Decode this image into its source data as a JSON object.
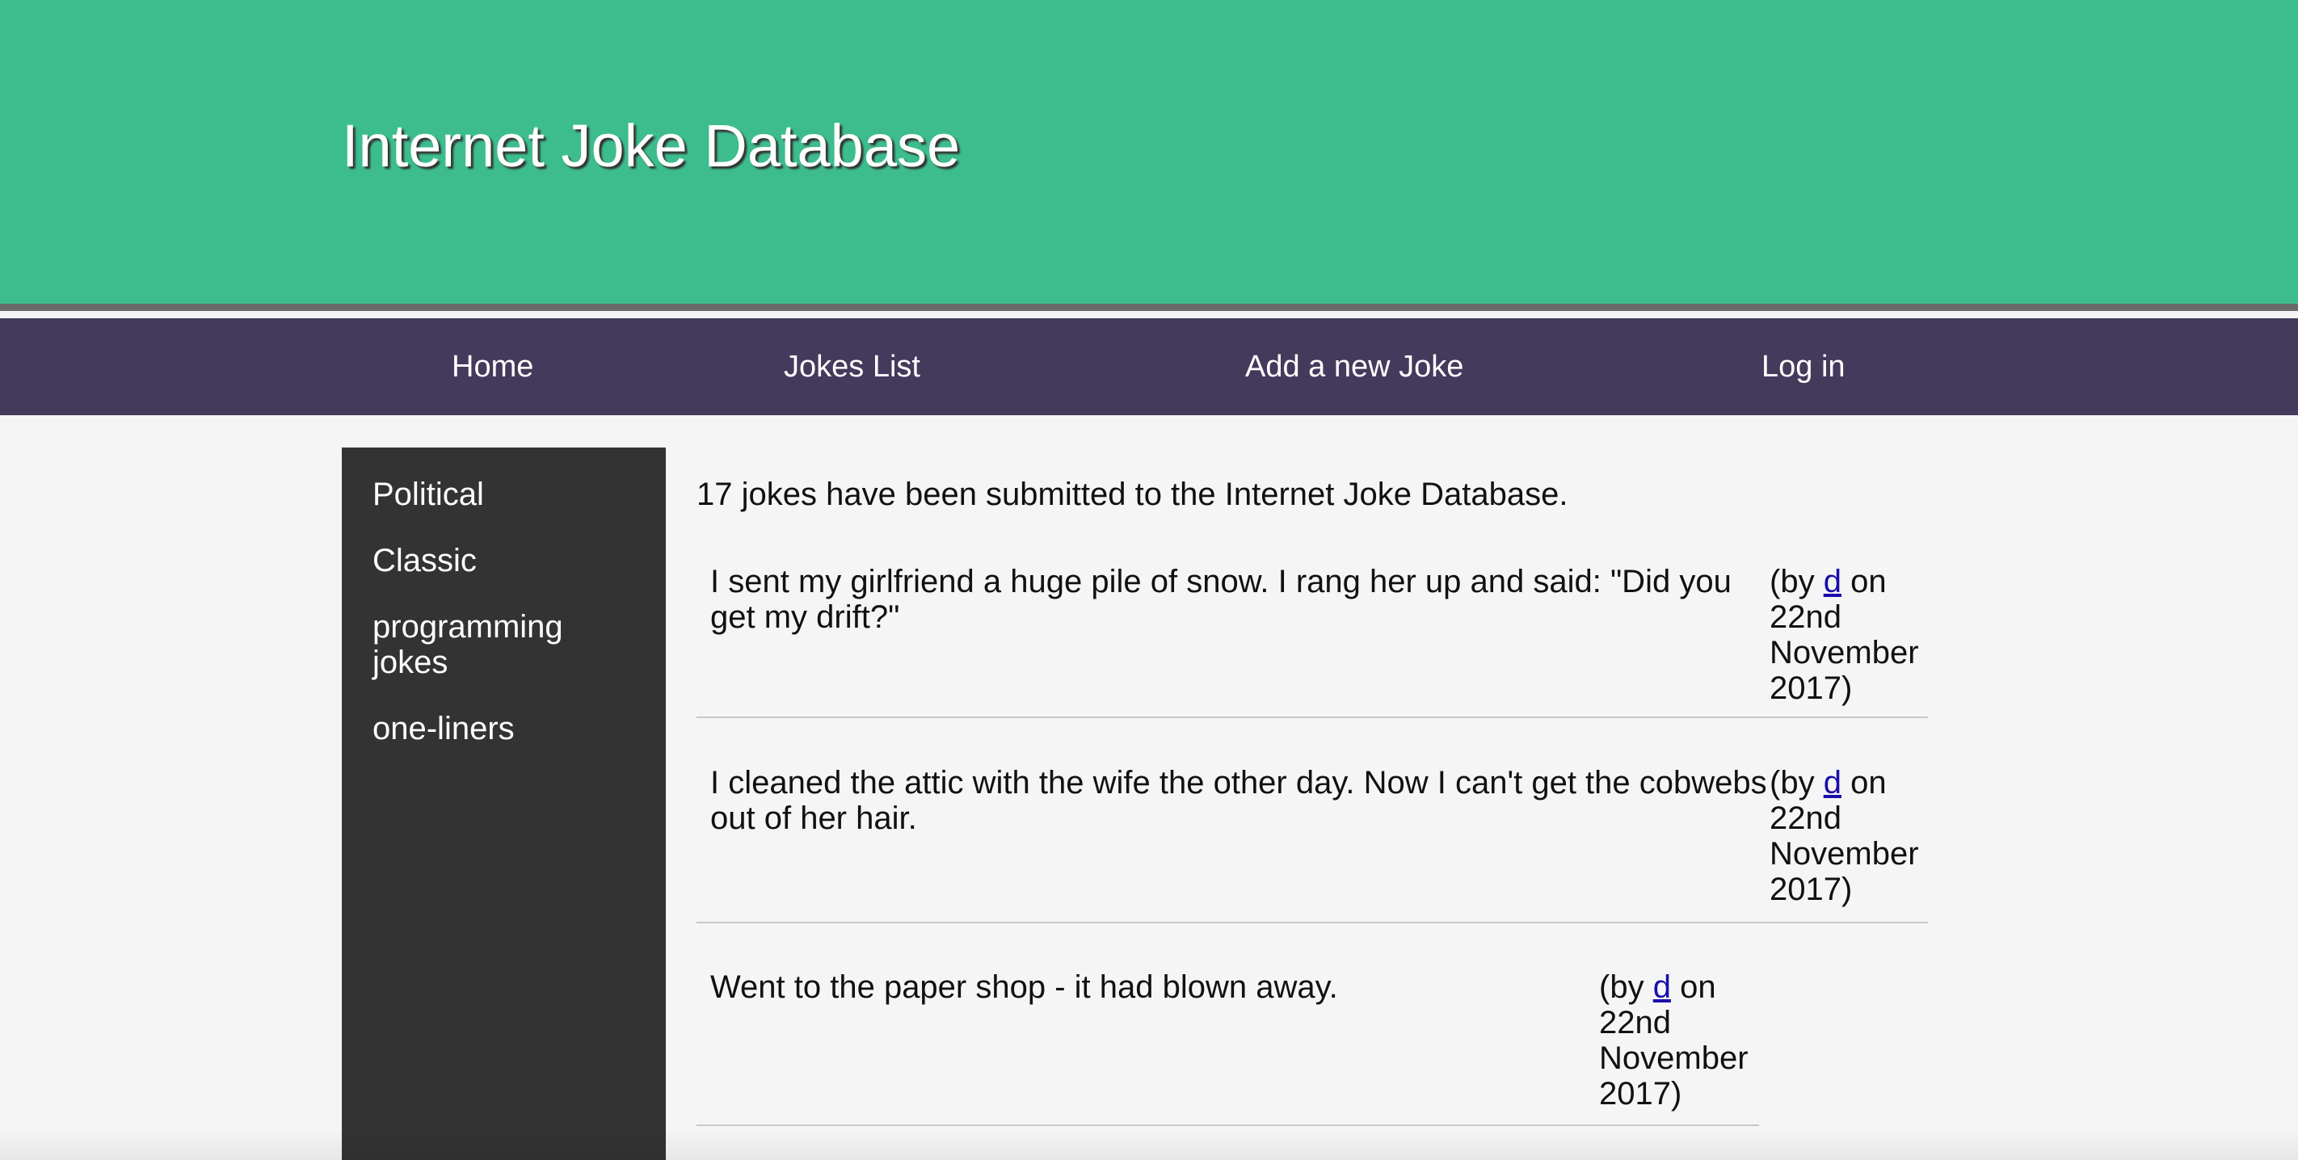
{
  "header": {
    "title": "Internet Joke Database"
  },
  "nav": {
    "items": [
      {
        "label": "Home"
      },
      {
        "label": "Jokes List"
      },
      {
        "label": "Add a new Joke"
      },
      {
        "label": "Log in"
      }
    ]
  },
  "sidebar": {
    "categories": [
      {
        "label": "Political"
      },
      {
        "label": "Classic"
      },
      {
        "label": "programming jokes"
      },
      {
        "label": "one-liners"
      }
    ]
  },
  "main": {
    "summary": "17 jokes have been submitted to the Internet Joke Database.",
    "jokes": [
      {
        "text": "I sent my girlfriend a huge pile of snow. I rang her up and said: \"Did you get my drift?\"",
        "by_prefix": "(by",
        "author": "d",
        "date_text": "on 22nd November 2017)"
      },
      {
        "text": "I cleaned the attic with the wife the other day. Now I can't get the cobwebs out of her hair.",
        "by_prefix": "(by",
        "author": "d",
        "date_text": "on 22nd November 2017)"
      },
      {
        "text": "Went to the paper shop - it had blown away.",
        "by_prefix": "(by",
        "author": "d",
        "date_text": "on 22nd November 2017)"
      }
    ]
  },
  "colors": {
    "header_bg": "#3dbd8d",
    "nav_bg": "#443a5b",
    "sidebar_bg": "#333333",
    "link": "#1a0dab"
  }
}
